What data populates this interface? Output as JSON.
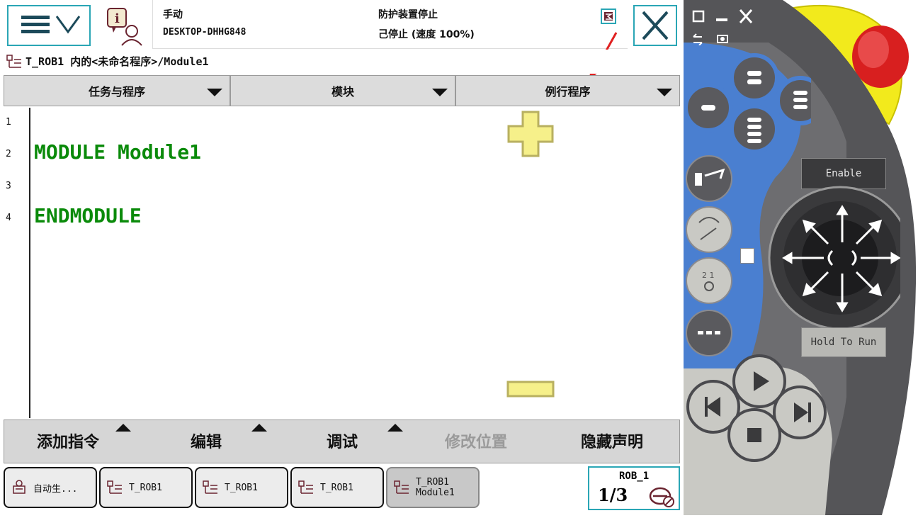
{
  "header": {
    "mode": "手动",
    "system_name": "DESKTOP-DHHG848",
    "safety_status": "防护装置停止",
    "run_status": "己停止 (速度 100%)"
  },
  "path": "T_ROB1 内的<未命名程序>/Module1",
  "columns": [
    "任务与程序",
    "模块",
    "例行程序"
  ],
  "editor": {
    "line_numbers": [
      "1",
      "2",
      "3",
      "4"
    ],
    "lines": [
      "",
      "MODULE Module1",
      "",
      "ENDMODULE"
    ]
  },
  "commands": {
    "add_instruction": "添加指令",
    "edit": "编辑",
    "debug": "调试",
    "modify_position": "修改位置",
    "hide_declarations": "隐藏声明"
  },
  "taskbar": [
    {
      "label": "自动生..."
    },
    {
      "label": "T_ROB1"
    },
    {
      "label": "T_ROB1"
    },
    {
      "label": "T_ROB1"
    },
    {
      "label": "T_ROB1\nModule1"
    }
  ],
  "robot_box": {
    "unit": "ROB_1",
    "fraction": "1/3"
  },
  "pendant": {
    "enable_label": "Enable",
    "hold_label": "Hold To Run"
  },
  "colors": {
    "accent": "#2aa6b5",
    "code_green": "#0a8a0a",
    "joystick_blue": "#4a7fd0",
    "estop_red": "#d81f1f",
    "estop_yellow": "#f2ea1c"
  }
}
